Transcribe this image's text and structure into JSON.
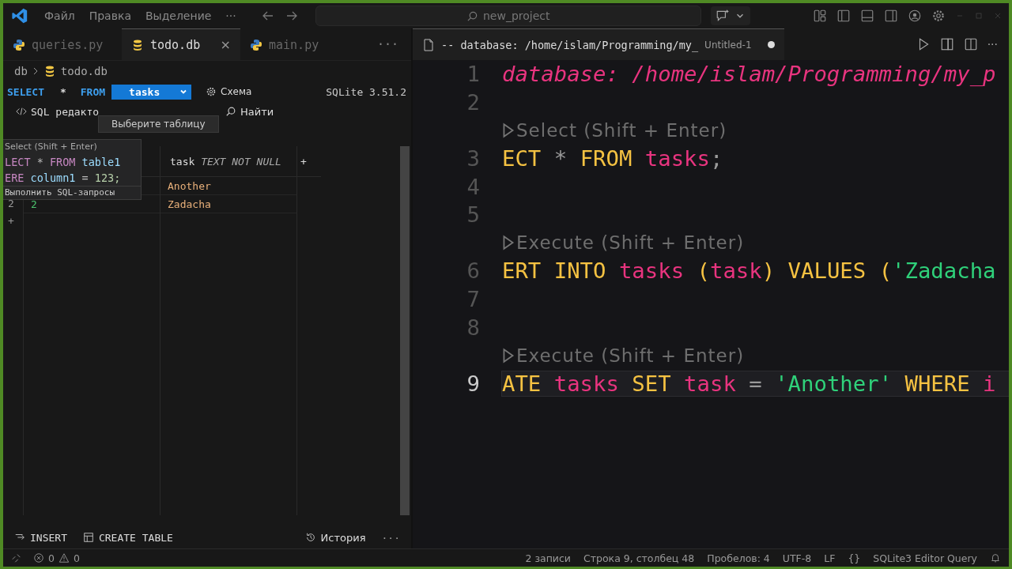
{
  "title_bar": {
    "menu": [
      "Файл",
      "Правка",
      "Выделение",
      "···"
    ],
    "search": "new_project"
  },
  "left_tabs": [
    {
      "label": "queries.py",
      "kind": "python",
      "selected": false
    },
    {
      "label": "todo.db",
      "kind": "database",
      "selected": true,
      "close": "×"
    },
    {
      "label": "main.py",
      "kind": "python",
      "selected": false
    }
  ],
  "left_tabs_more": "···",
  "breadcrumb": [
    "db",
    "todo.db"
  ],
  "query_bar": {
    "select": "SELECT",
    "star": "*",
    "from": "FROM",
    "table": "tasks",
    "schema": "Схема",
    "version": "SQLite 3.51.2"
  },
  "tools": [
    {
      "label": "SQL редакто",
      "kind": "code"
    },
    {
      "label": "Найти",
      "kind": "search"
    }
  ],
  "tooltip": "Выберите таблицу",
  "table": {
    "columns": [
      {
        "name": "task",
        "type": "TEXT NOT NULL"
      }
    ],
    "add_column": "+",
    "rows": [
      {
        "task": "Another"
      },
      {
        "row_number": "2",
        "id": "2",
        "task": "Zadacha"
      }
    ],
    "add_row": "+"
  },
  "hover": {
    "title": "Select (Shift + Enter)",
    "code": [
      [
        {
          "text": "LECT ",
          "kind": "keyword"
        },
        {
          "text": "* ",
          "kind": "operator"
        },
        {
          "text": "FROM ",
          "kind": "keyword"
        },
        {
          "text": "table1",
          "kind": "name"
        }
      ],
      [
        {
          "text": "ERE ",
          "kind": "keyword"
        },
        {
          "text": "column1 ",
          "kind": "name"
        },
        {
          "text": "= ",
          "kind": "operator"
        },
        {
          "text": "123;",
          "kind": "number"
        }
      ]
    ],
    "footer": "Выполнить SQL-запросы"
  },
  "bottom_actions": [
    {
      "label": "INSERT",
      "kind": "insert"
    },
    {
      "label": "CREATE TABLE",
      "kind": "table"
    }
  ],
  "history": "История",
  "bottom_more": "···",
  "editor_tab": {
    "title": "-- database: /home/islam/Programming/my_",
    "file": "Untitled-1",
    "dirty": true
  },
  "editor_more": "···",
  "lines": [
    {
      "kind": "code",
      "number": "1",
      "current": false,
      "tokens": [
        {
          "text": "database: /home/islam/Programming/my_p",
          "kind": "comment"
        }
      ]
    },
    {
      "kind": "code",
      "number": "2",
      "current": false
    },
    {
      "kind": "lens",
      "text": "Select (Shift + Enter)"
    },
    {
      "kind": "code",
      "number": "3",
      "current": false,
      "tokens": [
        {
          "text": "ECT ",
          "kind": "keyword"
        },
        {
          "text": "* ",
          "kind": "operator"
        },
        {
          "text": "FROM ",
          "kind": "keyword"
        },
        {
          "text": "tasks",
          "kind": "name"
        },
        {
          "text": ";",
          "kind": "operator"
        }
      ]
    },
    {
      "kind": "code",
      "number": "4",
      "current": false
    },
    {
      "kind": "code",
      "number": "5",
      "current": false
    },
    {
      "kind": "lens",
      "text": "Execute (Shift + Enter)"
    },
    {
      "kind": "code",
      "number": "6",
      "current": false,
      "tokens": [
        {
          "text": "ERT INTO ",
          "kind": "keyword"
        },
        {
          "text": "tasks ",
          "kind": "name"
        },
        {
          "text": "(",
          "kind": "keyword"
        },
        {
          "text": "task",
          "kind": "name"
        },
        {
          "text": ") VALUES (",
          "kind": "keyword"
        },
        {
          "text": "'Zadacha",
          "kind": "string"
        }
      ]
    },
    {
      "kind": "code",
      "number": "7",
      "current": false
    },
    {
      "kind": "code",
      "number": "8",
      "current": false
    },
    {
      "kind": "lens",
      "text": "Execute (Shift + Enter)"
    },
    {
      "kind": "code",
      "number": "9",
      "current": true,
      "tokens": [
        {
          "text": "ATE ",
          "kind": "keyword"
        },
        {
          "text": "tasks ",
          "kind": "name"
        },
        {
          "text": "SET ",
          "kind": "keyword"
        },
        {
          "text": "task ",
          "kind": "name"
        },
        {
          "text": "= ",
          "kind": "operator"
        },
        {
          "text": "'Another' ",
          "kind": "string"
        },
        {
          "text": "WHERE ",
          "kind": "keyword"
        },
        {
          "text": "i",
          "kind": "name"
        }
      ]
    }
  ],
  "status_bar": {
    "errors": "0",
    "warnings": "0",
    "items": [
      "2 записи",
      "Строка 9, столбец 48",
      "Пробелов: 4",
      "UTF-8",
      "LF",
      "{}",
      "SQLite3 Editor Query"
    ]
  }
}
